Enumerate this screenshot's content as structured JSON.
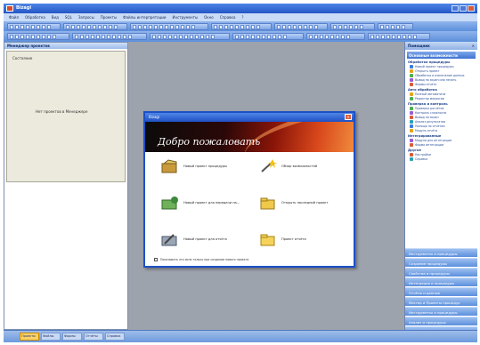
{
  "colors": {
    "accent": "#2356c7",
    "workspace": "#9da3ad",
    "banner": "#8a1508"
  },
  "window": {
    "title": "Bizagi"
  },
  "menu": [
    "Файл",
    "Обработка",
    "Вид",
    "SQL",
    "Запросы",
    "Проекты",
    "Файлы интерпретации",
    "Инструменты",
    "Окно",
    "Справка",
    "?"
  ],
  "left_pane": {
    "header": "Менеджер проектов",
    "label": "Состояние",
    "message": "Нет проектов в Менеджере"
  },
  "dialog": {
    "title": "Bizagi",
    "welcome": "Добро пожаловать",
    "options": [
      {
        "label": "Новый проект процедуры",
        "icon": "open-folder-icon"
      },
      {
        "label": "Обзор возможностей",
        "icon": "magic-wand-icon"
      },
      {
        "label": "Новый проект для передачи на…",
        "icon": "green-folder-icon"
      },
      {
        "label": "Открыть последний проект",
        "icon": "folder-icon"
      },
      {
        "label": "Новый проект для отчёта",
        "icon": "wrench-folder-icon"
      },
      {
        "label": "Проект отчёта",
        "icon": "yellow-folder-icon"
      }
    ],
    "footer": "Показывать это окно только при создании нового проекта"
  },
  "right_pane": {
    "header": "Помощник",
    "title": "Основные возможности",
    "sections": [
      {
        "title": "Обработка процедуры",
        "items": [
          "Новый проект процедуры",
          "Открыть проект",
          "Обработка и извлечение данных",
          "Вывод на экран или печать",
          "Формы отчёта"
        ]
      },
      {
        "title": "Авто обработка",
        "items": [
          "Полный автоматизм",
          "Редактор макросов"
        ]
      },
      {
        "title": "Проверка и контроль",
        "items": [
          "Проверка расчётов",
          "Контроль сложности",
          "Вывод на экран",
          "Анализ результатов",
          "Помощь по отчётам",
          "Модуль отчёта"
        ]
      },
      {
        "title": "Интегрированные",
        "items": [
          "Модули для интеграции",
          "Форма интеграции"
        ]
      },
      {
        "title": "Другое",
        "items": [
          "Настройки",
          "Справка"
        ]
      }
    ],
    "panels": [
      "Инструменты и процедуры",
      "Создание процедуры",
      "Свойства и процедуры",
      "Интеграция и процедуры",
      "Отчёты и данные",
      "Мастер и Проекты процедур",
      "Инструменты и процедуры",
      "Анализ и процедуры",
      "Справка и процедуры"
    ]
  },
  "bottom_tabs": [
    "Проекты",
    "Файлы",
    "Формы",
    "Отчёты",
    "Справка"
  ]
}
